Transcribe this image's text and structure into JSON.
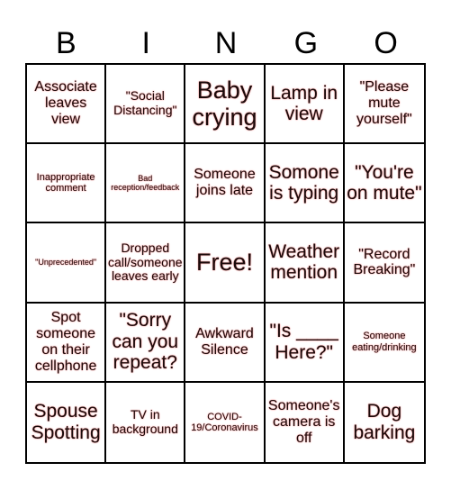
{
  "header": {
    "letters": [
      "B",
      "I",
      "N",
      "G",
      "O"
    ]
  },
  "board": {
    "cells": [
      {
        "text": "Associate leaves view",
        "size": "s-md"
      },
      {
        "text": "\"Social Distancing\"",
        "size": "s-sm"
      },
      {
        "text": "Baby crying",
        "size": "s-xl"
      },
      {
        "text": "Lamp in view",
        "size": "s-lg"
      },
      {
        "text": "\"Please mute yourself\"",
        "size": "s-md"
      },
      {
        "text": "Inappropriate comment",
        "size": "s-xs"
      },
      {
        "text": "Bad reception/feedback",
        "size": "s-xxs"
      },
      {
        "text": "Someone joins late",
        "size": "s-md"
      },
      {
        "text": "Somone is typing",
        "size": "s-lg"
      },
      {
        "text": "\"You're on mute\"",
        "size": "s-lg"
      },
      {
        "text": "\"Unprecedented\"",
        "size": "s-xxs"
      },
      {
        "text": "Dropped call/someone leaves early",
        "size": "s-sm"
      },
      {
        "text": "Free!",
        "size": "s-xl"
      },
      {
        "text": "Weather mention",
        "size": "s-lg"
      },
      {
        "text": "\"Record Breaking\"",
        "size": "s-md"
      },
      {
        "text": "Spot someone on their cellphone",
        "size": "s-md"
      },
      {
        "text": "\"Sorry can you repeat?",
        "size": "s-lg"
      },
      {
        "text": "Awkward Silence",
        "size": "s-md"
      },
      {
        "text": "\"Is ____ Here?\"",
        "size": "s-lg"
      },
      {
        "text": "Someone eating/drinking",
        "size": "s-xs"
      },
      {
        "text": "Spouse Spotting",
        "size": "s-lg"
      },
      {
        "text": "TV in background",
        "size": "s-sm"
      },
      {
        "text": "COVID-19/Coronavirus",
        "size": "s-xs"
      },
      {
        "text": "Someone's camera is off",
        "size": "s-md"
      },
      {
        "text": "Dog barking",
        "size": "s-lg"
      }
    ]
  },
  "colors": {
    "text": "#1a0a0a",
    "halo": "#f6a0a0",
    "grid": "#000000"
  }
}
